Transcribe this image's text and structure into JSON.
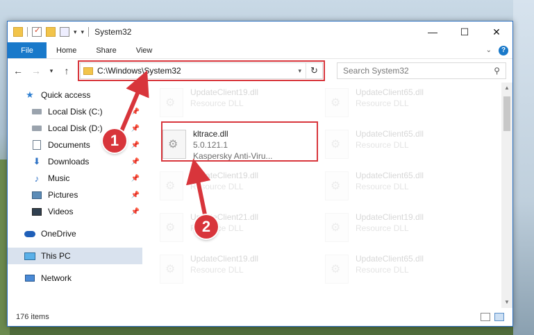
{
  "window": {
    "title": "System32",
    "controls": {
      "minimize": "—",
      "maximize": "☐",
      "close": "✕"
    }
  },
  "ribbon": {
    "tabs": [
      "File",
      "Home",
      "Share",
      "View"
    ]
  },
  "navigation": {
    "back": "←",
    "forward": "→",
    "recent": "▾",
    "up": "↑",
    "address": "C:\\Windows\\System32",
    "refresh": "↻",
    "search_placeholder": "Search System32"
  },
  "sidebar": {
    "items": [
      {
        "label": "Quick access",
        "icon": "star-icon"
      },
      {
        "label": "Local Disk (C:)",
        "icon": "disk-icon",
        "pinned": true
      },
      {
        "label": "Local Disk (D:)",
        "icon": "disk-icon",
        "pinned": true
      },
      {
        "label": "Documents",
        "icon": "documents-icon",
        "pinned": true
      },
      {
        "label": "Downloads",
        "icon": "downloads-icon",
        "pinned": true
      },
      {
        "label": "Music",
        "icon": "music-icon",
        "pinned": true
      },
      {
        "label": "Pictures",
        "icon": "pictures-icon",
        "pinned": true
      },
      {
        "label": "Videos",
        "icon": "videos-icon",
        "pinned": true
      },
      {
        "label": "OneDrive",
        "icon": "onedrive-icon"
      },
      {
        "label": "This PC",
        "icon": "this-pc-icon"
      },
      {
        "label": "Network",
        "icon": "network-icon"
      }
    ]
  },
  "files": {
    "left_column": [
      {
        "name": "UpdateClient19.dll",
        "type": "Resource DLL"
      },
      {
        "name": "kltrace.dll",
        "version": "5.0.121.1",
        "company": "Kaspersky Anti-Viru..."
      },
      {
        "name": "UpdateClient19.dll",
        "type": "Resource DLL"
      },
      {
        "name": "UpdateClient21.dll",
        "type": "Resource DLL"
      },
      {
        "name": "UpdateClient19.dll",
        "type": "Resource DLL"
      }
    ],
    "right_column": [
      {
        "name": "UpdateClient65.dll",
        "type": "Resource DLL"
      },
      {
        "name": "UpdateClient65.dll",
        "type": "Resource DLL"
      },
      {
        "name": "UpdateClient65.dll",
        "type": "Resource DLL"
      },
      {
        "name": "UpdateClient19.dll",
        "type": "Resource DLL"
      },
      {
        "name": "UpdateClient65.dll",
        "type": "Resource DLL"
      }
    ]
  },
  "status": {
    "item_count": "176 items"
  },
  "annotations": {
    "step1": "1",
    "step2": "2",
    "color": "#d8353b"
  }
}
